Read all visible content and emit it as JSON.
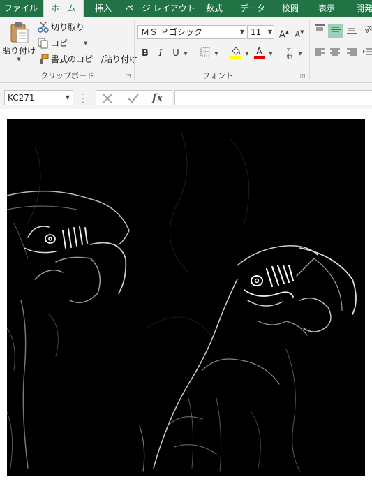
{
  "tabs": [
    {
      "label": "ファイル",
      "active": false
    },
    {
      "label": "ホーム",
      "active": true
    },
    {
      "label": "挿入",
      "active": false
    },
    {
      "label": "ページ レイアウト",
      "active": false
    },
    {
      "label": "数式",
      "active": false
    },
    {
      "label": "データ",
      "active": false
    },
    {
      "label": "校閲",
      "active": false
    },
    {
      "label": "表示",
      "active": false
    },
    {
      "label": "開発",
      "active": false
    }
  ],
  "clipboard": {
    "paste_label": "貼り付け",
    "cut_label": "切り取り",
    "copy_label": "コピー",
    "format_painter_label": "書式のコピー/貼り付け",
    "group_label": "クリップボード"
  },
  "font": {
    "font_name": "ＭＳ Ｐゴシック",
    "font_size": "11",
    "group_label": "フォント",
    "bold": "B",
    "italic": "I",
    "underline": "U",
    "font_color": "#e00000",
    "fill_color": "#ffff00"
  },
  "formula_bar": {
    "name_box": "KC271",
    "fx": "fx",
    "formula": ""
  },
  "colors": {
    "accent": "#217346",
    "align_highlight": "#9bd1b4"
  }
}
